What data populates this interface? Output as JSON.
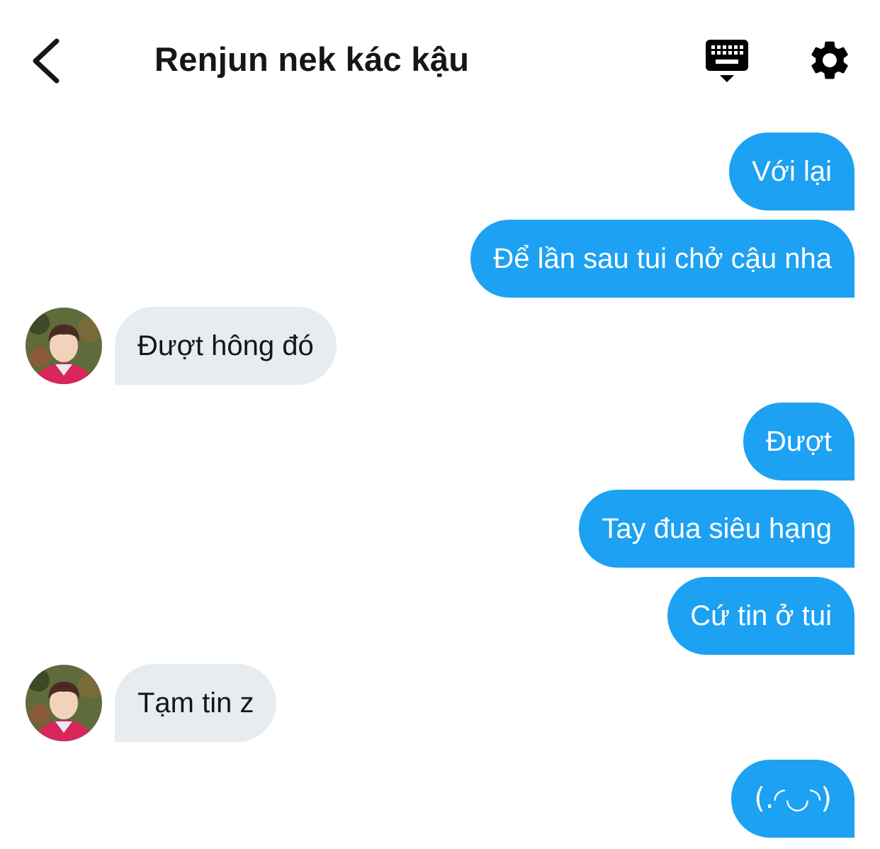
{
  "header": {
    "title": "Renjun nek kác kậu",
    "back_icon": "chevron-left-icon",
    "keyboard_icon": "keyboard-icon",
    "settings_icon": "gear-icon"
  },
  "colors": {
    "sent_bubble": "#1da1f2",
    "received_bubble": "#e6ecf0",
    "text_dark": "#14171a"
  },
  "messages": [
    {
      "direction": "sent",
      "text": "Với lại"
    },
    {
      "direction": "sent",
      "text": "Để lần sau tui chở cậu nha"
    },
    {
      "direction": "received",
      "text": "Đượt hông đó"
    },
    {
      "direction": "sent",
      "text": "Đượt"
    },
    {
      "direction": "sent",
      "text": "Tay đua siêu hạng"
    },
    {
      "direction": "sent",
      "text": "Cứ tin ở tui"
    },
    {
      "direction": "received",
      "text": "Tạm tin z"
    },
    {
      "direction": "sent",
      "text": "(.◜◡◝)"
    }
  ]
}
